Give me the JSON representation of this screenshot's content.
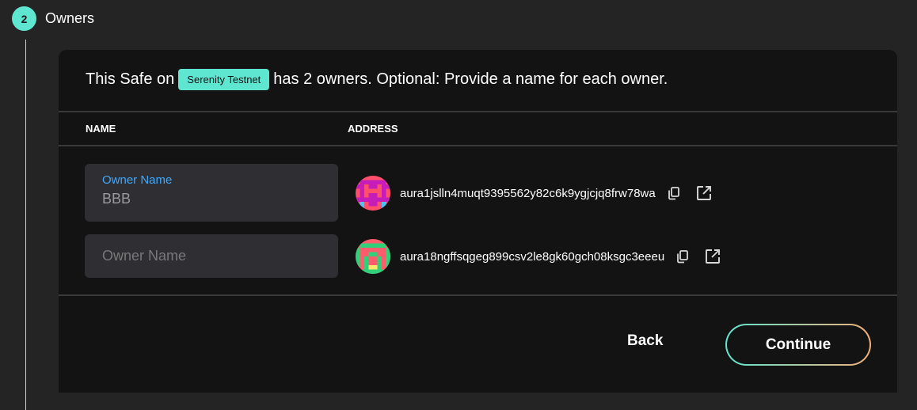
{
  "step": {
    "number": "2",
    "title": "Owners"
  },
  "intro": {
    "prefix": "This Safe on",
    "network": "Serenity Testnet",
    "suffix": "has 2 owners. Optional: Provide a name for each owner."
  },
  "table": {
    "name_header": "NAME",
    "address_header": "ADDRESS"
  },
  "owners": [
    {
      "label": "Owner Name",
      "value": "BBB",
      "address": "aura1jslln4muqt9395562y82c6k9ygjcjq8frw78wa",
      "avatar_icon": "identicon-avatar"
    },
    {
      "placeholder": "Owner Name",
      "value": "",
      "address": "aura18ngffsqgeg899csv2le8gk60gch08ksgc3eeeu",
      "avatar_icon": "identicon-avatar"
    }
  ],
  "icons": {
    "copy": "copy-icon",
    "external": "external-link-icon"
  },
  "actions": {
    "back": "Back",
    "continue": "Continue"
  },
  "colors": {
    "accent": "#5ee6d0",
    "gradient_end": "#f2b07a",
    "label_blue": "#3ea8ff",
    "card_bg": "#131313",
    "page_bg": "#242424"
  }
}
